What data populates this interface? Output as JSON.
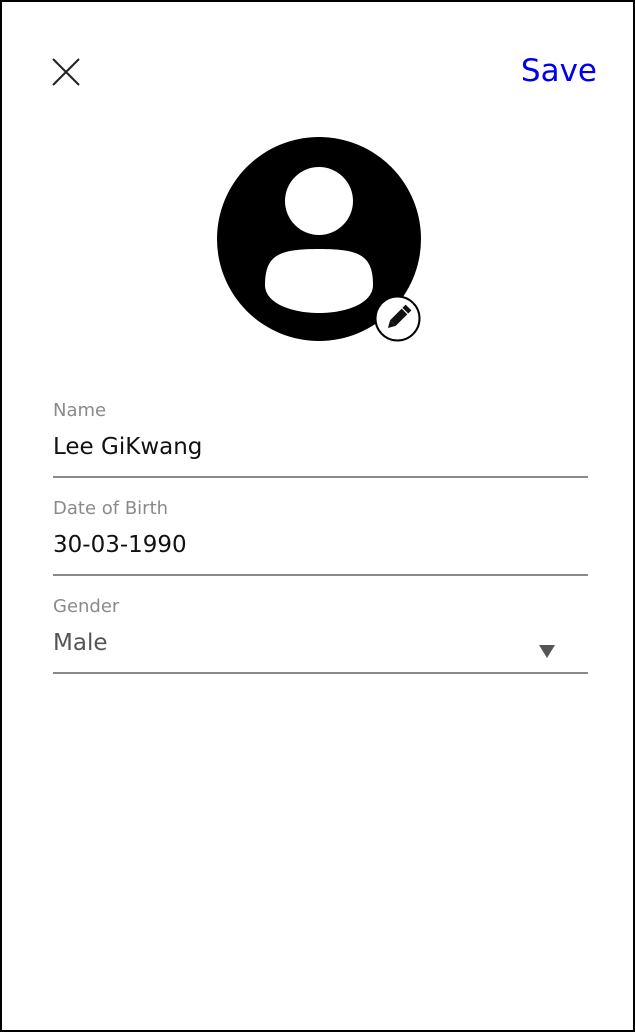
{
  "header": {
    "close_icon": "close-icon",
    "save_label": "Save",
    "save_color": "#0000ee"
  },
  "avatar": {
    "icon": "user-avatar-icon",
    "edit_icon": "pencil-icon"
  },
  "form": {
    "name": {
      "label": "Name",
      "value": "Lee GiKwang"
    },
    "dob": {
      "label": "Date of Birth",
      "value": "30-03-1990"
    },
    "gender": {
      "label": "Gender",
      "value": "Male",
      "options": [
        "Male"
      ]
    }
  }
}
